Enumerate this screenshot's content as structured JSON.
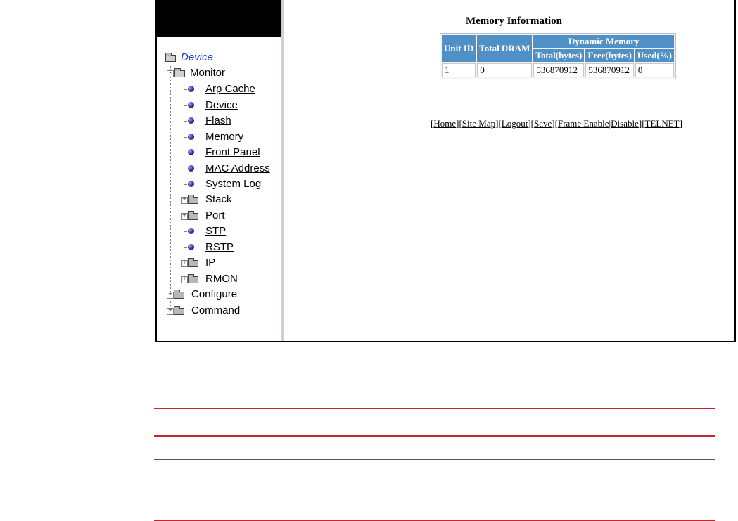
{
  "tree": {
    "root": "Device",
    "monitor": "Monitor",
    "monitor_items": [
      "Arp Cache",
      "Device",
      "Flash",
      "Memory",
      "Front Panel",
      "MAC Address",
      "System Log"
    ],
    "stack": "Stack",
    "port": "Port",
    "stp": "STP",
    "rstp": "RSTP",
    "ip": "IP",
    "rmon": "RMON",
    "configure": "Configure",
    "command": "Command",
    "expand_symbol": "+",
    "collapse_symbol": "-"
  },
  "memory": {
    "title": "Memory Information",
    "headers": {
      "unit_id": "Unit ID",
      "total_dram": "Total DRAM",
      "dynamic_memory": "Dynamic Memory",
      "total_bytes": "Total(bytes)",
      "free_bytes": "Free(bytes)",
      "used_pct": "Used(%)"
    },
    "row": {
      "unit_id": "1",
      "total_dram": "0",
      "total_bytes": "536870912",
      "free_bytes": "536870912",
      "used_pct": "0"
    }
  },
  "nav": {
    "home": "Home",
    "site_map": "Site Map",
    "logout": "Logout",
    "save": "Save",
    "frame_enable": "Frame Enable",
    "disable": "Disable",
    "telnet": "TELNET"
  },
  "colors": {
    "header_blue": "#4f90c6",
    "rule_red": "#c4262e"
  }
}
